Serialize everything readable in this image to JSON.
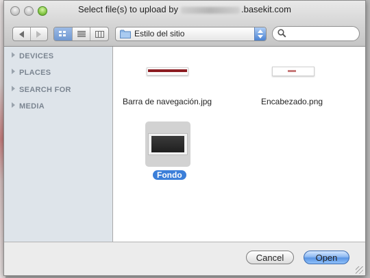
{
  "window": {
    "title_prefix": "Select file(s) to upload by",
    "title_suffix": ".basekit.com"
  },
  "toolbar": {
    "location_popup": "Estilo del sitio",
    "search_placeholder": ""
  },
  "sidebar": {
    "items": [
      {
        "label": "DEVICES"
      },
      {
        "label": "PLACES"
      },
      {
        "label": "SEARCH FOR"
      },
      {
        "label": "MEDIA"
      }
    ]
  },
  "files": [
    {
      "name": "Barra de navegación.jpg",
      "icon": "image-thumbnail"
    },
    {
      "name": "Encabezado.png",
      "icon": "image-thumbnail"
    },
    {
      "name": "Fondo",
      "icon": "image-thumbnail",
      "selected": true
    }
  ],
  "footer": {
    "cancel_label": "Cancel",
    "open_label": "Open"
  },
  "colors": {
    "selection": "#3b7fd9",
    "sidebar_bg": "#dee4ea",
    "default_button": "#5b95e4"
  }
}
